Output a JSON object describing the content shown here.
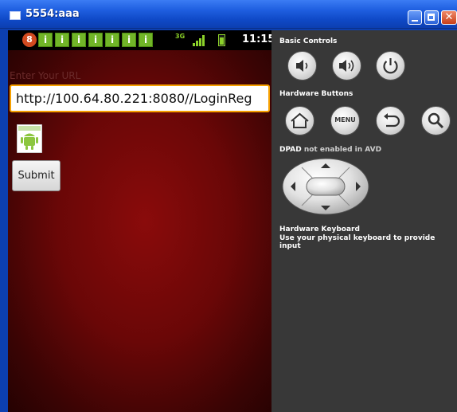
{
  "window": {
    "title": "5554:aaa"
  },
  "status_bar": {
    "notification_count": "8",
    "notification_glyph": "i",
    "network": "3G",
    "time": "11:15"
  },
  "app": {
    "url_label": "Enter Your URL",
    "url_value": "http://100.64.80.221:8080//LoginReg",
    "submit_label": "Submit"
  },
  "controls": {
    "basic_title": "Basic Controls",
    "hardware_title": "Hardware Buttons",
    "menu_label": "MENU",
    "dpad_title": "DPAD",
    "dpad_note": "not enabled in AVD",
    "keyboard_title": "Hardware Keyboard",
    "keyboard_note": "Use your physical keyboard to provide input"
  },
  "icons": [
    "window-icon",
    "minimize-icon",
    "maximize-icon",
    "close-icon",
    "notification-icon",
    "signal-icon",
    "battery-icon",
    "volume-down-icon",
    "volume-up-icon",
    "power-icon",
    "home-icon",
    "back-icon",
    "search-icon",
    "android-icon"
  ],
  "colors": {
    "titlebar": "#1f5fe0",
    "status_green": "#8bd12a",
    "input_focus": "#f6a000",
    "panel": "#383838",
    "screen_red": "#6a0707"
  }
}
